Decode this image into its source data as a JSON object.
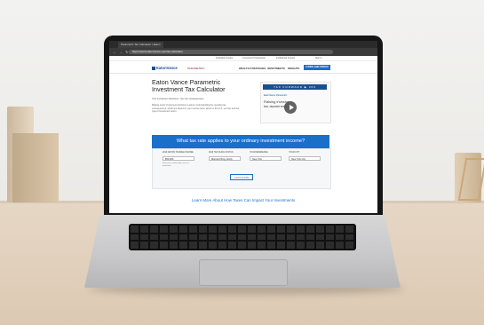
{
  "browser": {
    "tab_title": "Parametric Tax Calculator | Eaton",
    "url": "https://www.eatonvance.com/tax-calculator",
    "nav_icons": "← → ↻",
    "utility_links": [
      "Individual Investor",
      "Investment Professional",
      "Institutional Investor",
      "Sign In"
    ]
  },
  "site": {
    "logo": "EatonVance",
    "partner": "PARAMETRIC",
    "nav": [
      "WEALTH STRATEGIES",
      "INVESTMENTS",
      "INSIGHTS"
    ],
    "fund_button": "FUNDS AND PRICES"
  },
  "hero": {
    "title": "Eaton Vance Parametric Investment Tax Calculator",
    "subtitle": "Your investment decisions. Your tax consequences.",
    "body": "Making smart investment decisions requires understanding the resulting tax consequences, which are based on your income level, where in the U.S. you live and the type of investment return."
  },
  "video": {
    "bar": "TAX FORWARD ▶ 360",
    "logos": "EatonVance  Parametric",
    "text": "Raising investor tax awareness"
  },
  "calculator": {
    "heading": "What tax rate applies to your ordinary investment income?",
    "fields": [
      {
        "label": "2019 GROSS TAXABLE INCOME",
        "value": "$50,000"
      },
      {
        "label": "2019 TAX FILING STATUS",
        "value": "Married Filing Jointly"
      },
      {
        "label": "YOUR RESIDENCE",
        "value": "New York"
      },
      {
        "label": "YOUR CITY",
        "value": "New York City"
      }
    ],
    "note": "Enter your income before any tax deductions.",
    "button": "CALCULATE"
  },
  "learn_more": "Learn More About How Taxes Can Impact Your Investments"
}
